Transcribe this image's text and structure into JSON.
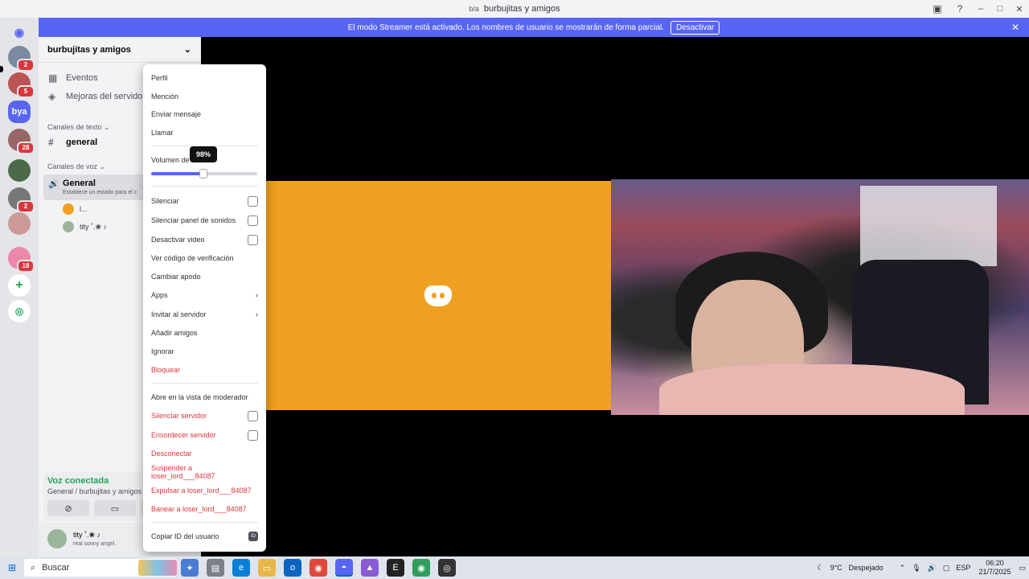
{
  "window": {
    "title": "burbujitas y amigos"
  },
  "streamer_bar": {
    "message": "El modo Streamer está activado. Los nombres de usuario se mostrarán de forma parcial.",
    "button": "Desactivar"
  },
  "server_list": {
    "badges": [
      "2",
      "5",
      "28",
      "2",
      "18"
    ],
    "bya_label": "bya"
  },
  "sidebar": {
    "server_name": "burbujitas y amigos",
    "events": "Eventos",
    "boosts": "Mejoras del servidor",
    "text_category": "Canales de texto",
    "text_channel": "general",
    "voice_category": "Canales de voz",
    "voice_channel": "General",
    "voice_status": "Establece un estado para el c",
    "voice_users": [
      "l...",
      "tity ˚.❀ ♪"
    ]
  },
  "voice_panel": {
    "title": "Voz conectada",
    "subtitle": "General / burbujitas y amigos"
  },
  "user_panel": {
    "name": "tity ˚.❀ ♪",
    "status": "real sonny angel."
  },
  "context_menu": {
    "profile": "Perfil",
    "mention": "Mención",
    "send_message": "Enviar mensaje",
    "call": "Llamar",
    "volume_label": "Volumen de",
    "volume_tooltip": "98%",
    "volume_value": 0.49,
    "mute": "Silenciar",
    "mute_soundboard": "Silenciar panel de sonidos",
    "disable_video": "Desactivar video",
    "verification": "Ver código de verificación",
    "change_nick": "Cambiar apodo",
    "apps": "Apps",
    "invite": "Invitar al servidor",
    "add_friend": "Añadir amigos",
    "ignore": "Ignorar",
    "block": "Bloquear",
    "mod_view": "Abre en la vista de moderador",
    "server_mute": "Silenciar servidor",
    "server_deafen": "Ensordecer servidor",
    "disconnect": "Desconectar",
    "suspend": "Suspender a loser_lord___84087",
    "kick": "Expulsar a loser_lord___84087",
    "ban": "Banear a loser_lord___84087",
    "copy_id": "Copiar ID del usuario",
    "id_badge": "ID"
  },
  "taskbar": {
    "search": "Buscar",
    "weather_temp": "9°C",
    "weather_text": "Despejado",
    "lang": "ESP",
    "time": "06:20",
    "date": "21/7/2025"
  },
  "colors": {
    "blurple": "#5865f2",
    "danger": "#da373c",
    "online": "#23a55a",
    "orange_tile": "#f0a020"
  }
}
